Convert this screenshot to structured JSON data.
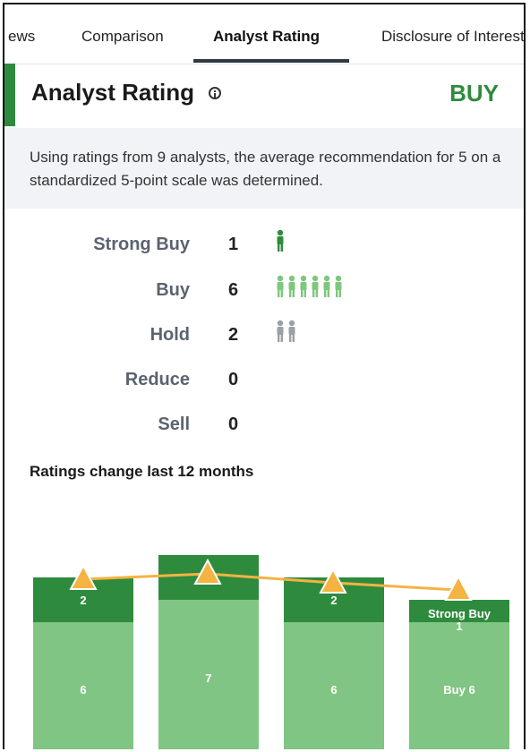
{
  "tabs": [
    {
      "label": "ews"
    },
    {
      "label": "Comparison"
    },
    {
      "label": "Analyst Rating",
      "active": true
    },
    {
      "label": "Disclosure of Interest"
    }
  ],
  "header": {
    "title": "Analyst Rating",
    "info_icon": "info-circle-icon",
    "recommendation": "BUY",
    "recommendation_color": "#2e8b3e"
  },
  "summary": "Using ratings from 9 analysts, the average recommendation for 5 on a standardized 5-point scale was determined.",
  "ratings": [
    {
      "label": "Strong Buy",
      "count": "1",
      "icon": "person-icon",
      "color": "#2e8b3e"
    },
    {
      "label": "Buy",
      "count": "6",
      "icon": "person-icon",
      "color": "#7ec77e"
    },
    {
      "label": "Hold",
      "count": "2",
      "icon": "person-icon",
      "color": "#9aa0a6"
    },
    {
      "label": "Reduce",
      "count": "0",
      "icon": "person-icon",
      "color": "#9aa0a6"
    },
    {
      "label": "Sell",
      "count": "0",
      "icon": "person-icon",
      "color": "#9aa0a6"
    }
  ],
  "chart_title": "Ratings change last 12 months",
  "chart_data": {
    "type": "bar",
    "stacked": true,
    "categories": [
      "",
      "",
      "",
      ""
    ],
    "series": [
      {
        "name": "Buy",
        "values": [
          6,
          7,
          6,
          6
        ],
        "color": "#80c583"
      },
      {
        "name": "Strong Buy",
        "values": [
          2,
          2,
          2,
          1
        ],
        "color": "#2e8b3e"
      }
    ],
    "bar_labels": [
      {
        "top": "2",
        "bottom": "6"
      },
      {
        "top": "",
        "bottom": "7"
      },
      {
        "top": "2",
        "bottom": "6"
      },
      {
        "top": "Strong Buy 1",
        "bottom": "Buy 6"
      }
    ],
    "trend_line": {
      "color": "#f5b342",
      "marker": "triangle"
    }
  }
}
